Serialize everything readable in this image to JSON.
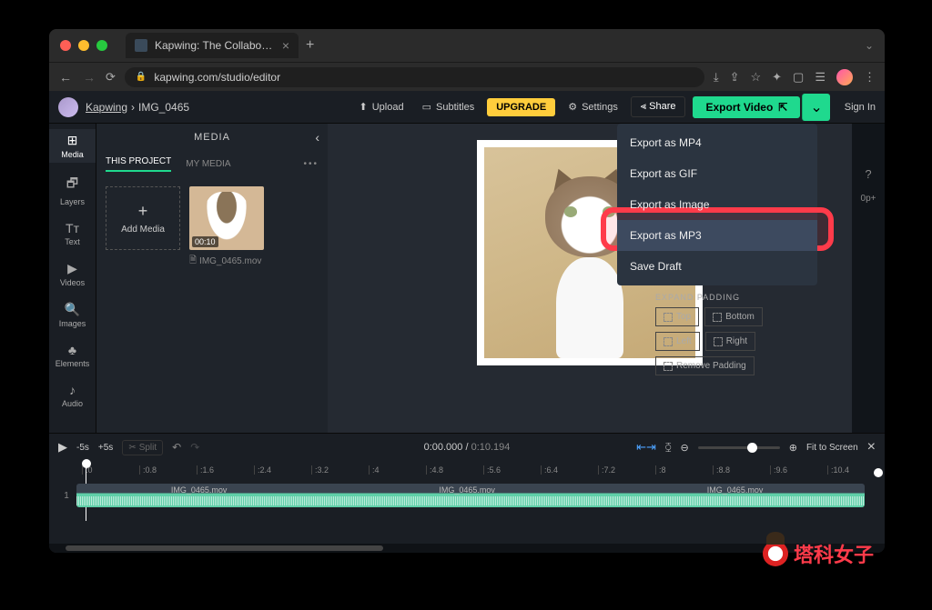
{
  "browser": {
    "tab_title": "Kapwing: The Collaborative Onl",
    "url": "kapwing.com/studio/editor"
  },
  "topbar": {
    "app_name": "Kapwing",
    "project_name": "IMG_0465",
    "upload": "Upload",
    "subtitles": "Subtitles",
    "upgrade": "UPGRADE",
    "settings": "Settings",
    "share": "Share",
    "export": "Export Video",
    "signin": "Sign In"
  },
  "rail": {
    "media": "Media",
    "layers": "Layers",
    "text": "Text",
    "videos": "Videos",
    "images": "Images",
    "elements": "Elements",
    "audio": "Audio"
  },
  "panel": {
    "title": "MEDIA",
    "tab_project": "THIS PROJECT",
    "tab_mymedia": "MY MEDIA",
    "add_media": "Add Media",
    "thumb_duration": "00:10",
    "thumb_name": "IMG_0465.mov"
  },
  "export_menu": {
    "mp4": "Export as MP4",
    "gif": "Export as GIF",
    "image": "Export as Image",
    "mp3": "Export as MP3",
    "draft": "Save Draft"
  },
  "right_side": {
    "resolution": "0p+"
  },
  "props": {
    "title": "EXPAND PADDING",
    "top": "Top",
    "bottom": "Bottom",
    "left": "Left",
    "right": "Right",
    "remove": "Remove Padding"
  },
  "timeline": {
    "back5": "-5s",
    "fwd5": "+5s",
    "split": "Split",
    "current": "0:00.000",
    "total": "0:10.194",
    "fit": "Fit to Screen",
    "ticks": [
      ":0",
      ":0.8",
      ":1.6",
      ":2.4",
      ":3.2",
      ":4",
      ":4.8",
      ":5.6",
      ":6.4",
      ":7.2",
      ":8",
      ":8.8",
      ":9.6",
      ":10.4"
    ],
    "track_num": "1",
    "clip_name": "IMG_0465.mov"
  },
  "watermark": "塔科女子"
}
